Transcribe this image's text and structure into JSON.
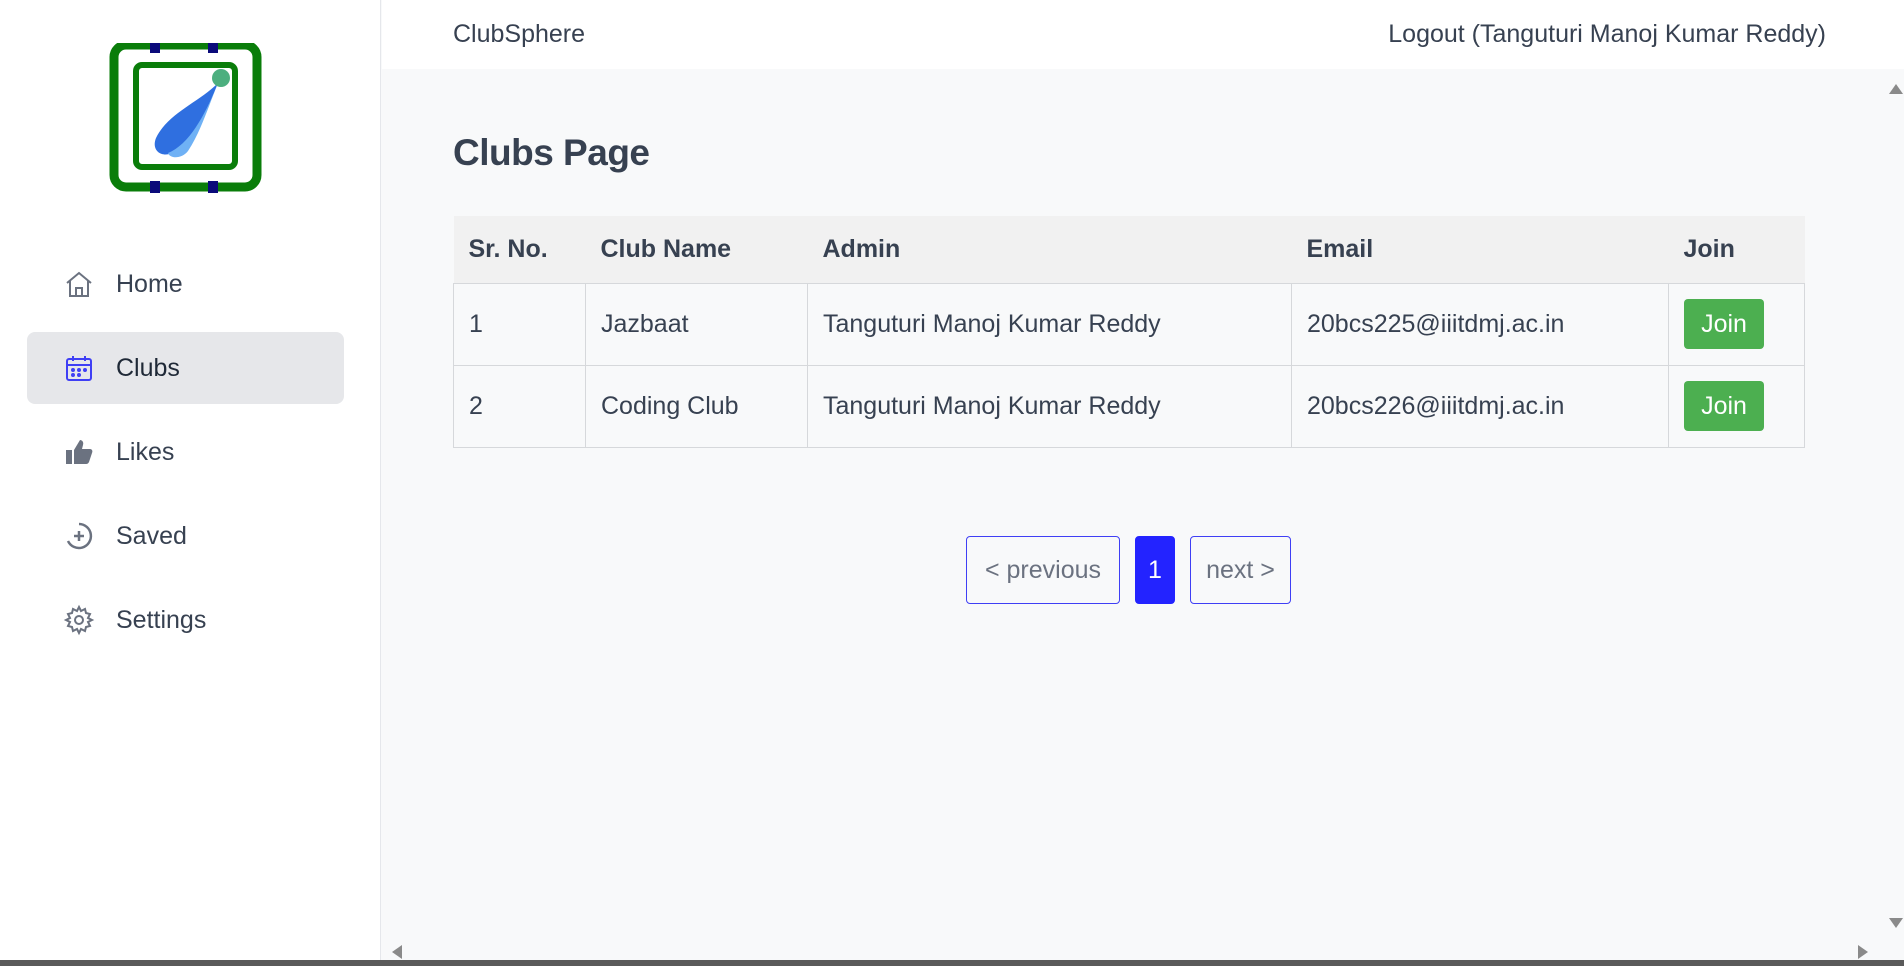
{
  "app": {
    "name": "ClubSphere",
    "logout_label": "Logout (Tanguturi Manoj Kumar Reddy)"
  },
  "sidebar": {
    "items": [
      {
        "label": "Home",
        "icon": "home-icon"
      },
      {
        "label": "Clubs",
        "icon": "calendar-icon",
        "active": true
      },
      {
        "label": "Likes",
        "icon": "thumbs-up-icon"
      },
      {
        "label": "Saved",
        "icon": "plus-circle-icon"
      },
      {
        "label": "Settings",
        "icon": "gear-icon"
      }
    ]
  },
  "main": {
    "title": "Clubs Page",
    "table": {
      "headers": [
        "Sr. No.",
        "Club Name",
        "Admin",
        "Email",
        "Join"
      ],
      "rows": [
        {
          "sr": "1",
          "club": "Jazbaat",
          "admin": "Tanguturi Manoj Kumar Reddy",
          "email": "20bcs225@iiitdmj.ac.in",
          "join": "Join"
        },
        {
          "sr": "2",
          "club": "Coding Club",
          "admin": "Tanguturi Manoj Kumar Reddy",
          "email": "20bcs226@iiitdmj.ac.in",
          "join": "Join"
        }
      ]
    },
    "pagination": {
      "previous": "< previous",
      "current": "1",
      "next": "next >"
    }
  },
  "colors": {
    "accent": "#2323ff",
    "join_button": "#4caf50",
    "logo_green": "#0a7d0a",
    "logo_navy": "#0a0a7a",
    "logo_blue": "#2f6fe0"
  }
}
